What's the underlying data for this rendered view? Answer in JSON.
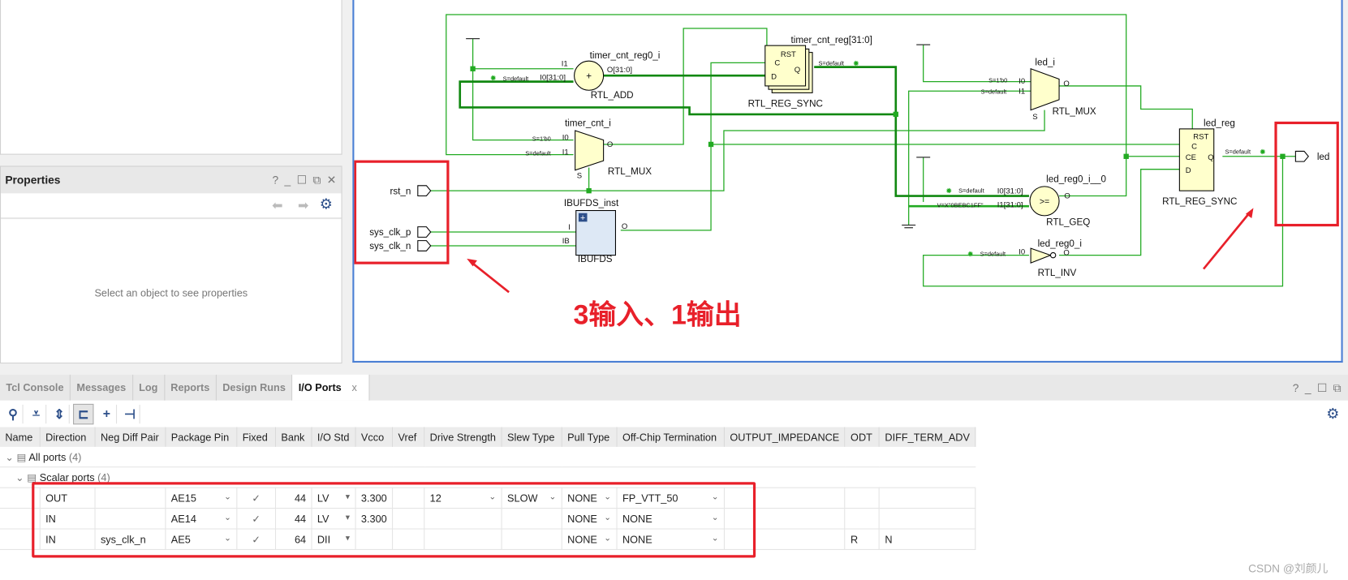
{
  "properties": {
    "title": "Properties",
    "controls": [
      "?",
      "_",
      "☐",
      "⧉",
      "✕"
    ],
    "empty_text": "Select an object to see properties"
  },
  "schematic": {
    "ports": {
      "rst_n": "rst_n",
      "sys_clk_p": "sys_clk_p",
      "sys_clk_n": "sys_clk_n",
      "led": "led"
    },
    "add": {
      "inst": "timer_cnt_reg0_i",
      "type": "RTL_ADD",
      "i1": "I1",
      "i0": "I0[31:0]",
      "o": "O[31:0]",
      "sym": "+",
      "attr": "S=default"
    },
    "reg": {
      "inst": "timer_cnt_reg[31:0]",
      "type": "RTL_REG_SYNC",
      "rst": "RST",
      "c": "C",
      "d": "D",
      "q": "Q",
      "attr": "S=default"
    },
    "mux1": {
      "inst": "timer_cnt_i",
      "type": "RTL_MUX",
      "i0": "I0",
      "i1": "I1",
      "o": "O",
      "s": "S",
      "a0": "S=1'b0",
      "a1": "S=default"
    },
    "ibuf": {
      "inst": "IBUFDS_inst",
      "type": "IBUFDS",
      "i": "I",
      "ib": "IB",
      "o": "O"
    },
    "mux2": {
      "inst": "led_i",
      "type": "RTL_MUX",
      "i0": "I0",
      "i1": "I1",
      "o": "O",
      "s": "S",
      "a0": "S=1'b0",
      "a1": "S=default"
    },
    "geq": {
      "inst": "led_reg0_i__0",
      "type": "RTL_GEQ",
      "sym": ">=",
      "i0": "I0[31:0]",
      "i1": "I1[31:0]",
      "o": "O",
      "attr": "S=default",
      "const": "V=X\"0BEBC1FF\""
    },
    "ledreg": {
      "inst": "led_reg",
      "type": "RTL_REG_SYNC",
      "rst": "RST",
      "c": "C",
      "ce": "CE",
      "d": "D",
      "q": "Q",
      "attr": "S=default"
    },
    "inv": {
      "inst": "led_reg0_i",
      "type": "RTL_INV",
      "i0": "I0",
      "o": "O",
      "attr": "S=default"
    },
    "annotation": "3输入、1输出",
    "colors": {
      "wire": "#22aa22",
      "bus": "#118811",
      "cell": "#ffffcc",
      "highlight": "#e8202a",
      "border": "#4a7fd4"
    }
  },
  "bottom": {
    "tabs": [
      "Tcl Console",
      "Messages",
      "Log",
      "Reports",
      "Design Runs",
      "I/O Ports"
    ],
    "active_tab": "I/O Ports",
    "close": "x",
    "controls": [
      "?",
      "_",
      "☐",
      "⧉"
    ],
    "toolbar": [
      "search-icon",
      "collapse-all-icon",
      "expand-all-icon",
      "group-icon",
      "add-icon",
      "auto-assign-icon"
    ],
    "columns": [
      "Name",
      "Direction",
      "Neg Diff Pair",
      "Package Pin",
      "Fixed",
      "Bank",
      "I/O Std",
      "Vcco",
      "Vref",
      "Drive Strength",
      "Slew Type",
      "Pull Type",
      "Off-Chip Termination",
      "OUTPUT_IMPEDANCE",
      "ODT",
      "DIFF_TERM_ADV"
    ],
    "groups": [
      {
        "label": "All ports",
        "count": "(4)"
      },
      {
        "label": "Scalar ports",
        "count": "(4)"
      }
    ],
    "rows": [
      {
        "name": "",
        "direction": "OUT",
        "neg": "",
        "pin": "AE15",
        "fixed": "✓",
        "bank": "44",
        "iostd": "LV",
        "vcco": "3.300",
        "vref": "",
        "drive": "12",
        "slew": "SLOW",
        "pull": "NONE",
        "term": "FP_VTT_50",
        "imp": "",
        "odt": "",
        "diff": ""
      },
      {
        "name": "",
        "direction": "IN",
        "neg": "",
        "pin": "AE14",
        "fixed": "✓",
        "bank": "44",
        "iostd": "LV",
        "vcco": "3.300",
        "vref": "",
        "drive": "",
        "slew": "",
        "pull": "NONE",
        "term": "NONE",
        "imp": "",
        "odt": "",
        "diff": ""
      },
      {
        "name": "",
        "direction": "IN",
        "neg": "sys_clk_n",
        "pin": "AE5",
        "fixed": "✓",
        "bank": "64",
        "iostd": "DII",
        "vcco": "",
        "vref": "",
        "drive": "",
        "slew": "",
        "pull": "NONE",
        "term": "NONE",
        "imp": "",
        "odt": "R",
        "diff": "N"
      }
    ]
  },
  "watermark": "CSDN @刘颜儿"
}
